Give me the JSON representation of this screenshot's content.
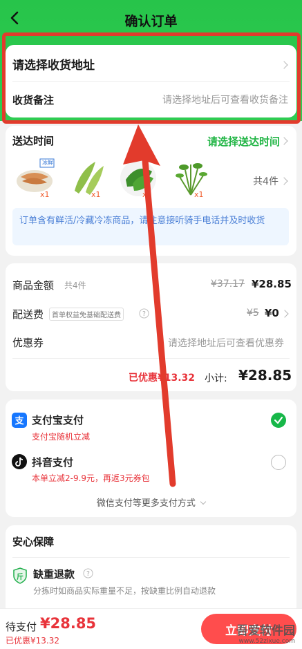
{
  "header": {
    "title": "确认订单"
  },
  "address": {
    "select_label": "请选择收货地址",
    "remark_label": "收货备注",
    "remark_hint": "请选择地址后可查看收货备注"
  },
  "delivery": {
    "title": "送达时间",
    "select_label": "请选择送达时间",
    "items": [
      {
        "name": "product-shrimp",
        "qty": "x1",
        "badge": "冰鲜"
      },
      {
        "name": "product-peppers",
        "qty": "x1"
      },
      {
        "name": "product-green-pepper",
        "qty": "x1"
      },
      {
        "name": "product-greens",
        "qty": "x1"
      }
    ],
    "total_count": "共4件",
    "notice": "订单含有鲜活/冷藏冷冻商品，请注意接听骑手电话并及时收货"
  },
  "summary": {
    "goods_label": "商品金额",
    "goods_count": "共4件",
    "goods_original": "¥37.17",
    "goods_price": "¥28.85",
    "delivery_label": "配送费",
    "delivery_tag": "首单权益免基础配送费",
    "delivery_original": "¥5",
    "delivery_price": "¥0",
    "coupon_label": "优惠券",
    "coupon_hint": "请选择地址后可查看优惠券",
    "discount": "已优惠¥13.32",
    "subtotal_label": "小计:",
    "subtotal": "¥28.85"
  },
  "payment": {
    "alipay_label": "支付宝支付",
    "alipay_promo": "支付宝随机立减",
    "douyin_label": "抖音支付",
    "douyin_promo": "本单立减2-9.9元，再返3元券包",
    "more_label": "微信支付等更多支付方式"
  },
  "guarantee": {
    "title": "安心保障",
    "item_label": "缺重退款",
    "item_icon_text": "斤",
    "item_desc": "分拣时如商品实际重量不足，按缺重比例自动退款"
  },
  "bottom_bar": {
    "pay_label": "待支付",
    "pay_amount": "¥28.85",
    "pay_discount": "已优惠¥13.32",
    "submit_label": "立即支付"
  },
  "watermark": {
    "text": "吾爱软件园",
    "url": "www.52zixue.com"
  },
  "colors": {
    "brand_green": "#27c44a",
    "price_red": "#e8333a",
    "annotation_red": "#e23b2c"
  }
}
